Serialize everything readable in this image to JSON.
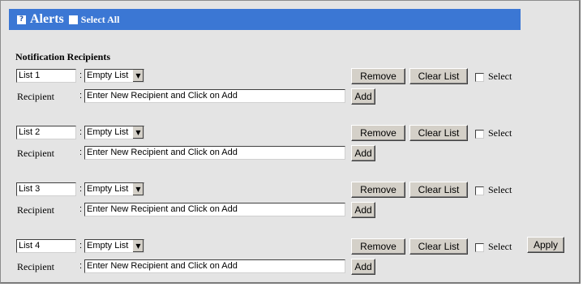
{
  "header": {
    "help_icon": "?",
    "title": "Alerts",
    "select_all_label": "Select All"
  },
  "section_title": "Notification Recipients",
  "groups": [
    {
      "list_name": "List 1",
      "list_select": "Empty List",
      "recipient_label": "Recipient",
      "recipient_value": "Enter New Recipient and Click on Add",
      "remove_label": "Remove",
      "clear_label": "Clear List",
      "select_label": "Select",
      "add_label": "Add"
    },
    {
      "list_name": "List 2",
      "list_select": "Empty List",
      "recipient_label": "Recipient",
      "recipient_value": "Enter New Recipient and Click on Add",
      "remove_label": "Remove",
      "clear_label": "Clear List",
      "select_label": "Select",
      "add_label": "Add"
    },
    {
      "list_name": "List 3",
      "list_select": "Empty List",
      "recipient_label": "Recipient",
      "recipient_value": "Enter New Recipient and Click on Add",
      "remove_label": "Remove",
      "clear_label": "Clear List",
      "select_label": "Select",
      "add_label": "Add"
    },
    {
      "list_name": "List 4",
      "list_select": "Empty List",
      "recipient_label": "Recipient",
      "recipient_value": "Enter New Recipient and Click on Add",
      "remove_label": "Remove",
      "clear_label": "Clear List",
      "select_label": "Select",
      "add_label": "Add"
    }
  ],
  "apply_label": "Apply",
  "colon": ":",
  "dropdown_arrow": "▼"
}
